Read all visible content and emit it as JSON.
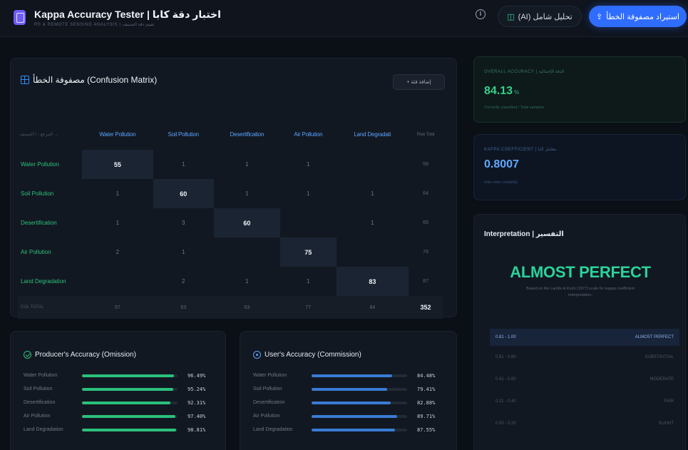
{
  "header": {
    "title": "Kappa Accuracy Tester | اختبار دقة كابا",
    "subtitle": "RS & REMOTE SENSING ANALYSIS | تقييم دقة التصنيف",
    "ai_button": "(AI) تحليل شامل",
    "import_button": "استيراد مصفوفة الخطأ"
  },
  "matrix": {
    "title": "مصفوفة الخطأ (Confusion Matrix)",
    "add_button": "+ إضافة فئة",
    "corner": "المرجع ↓ / المصنف →",
    "columns": [
      "Water Pollution",
      "Soil Pollution",
      "Desertification",
      "Air Pollution",
      "Land Degradati"
    ],
    "total_header": "Row Total",
    "rows": [
      {
        "name": "Water Pollution",
        "values": [
          "55",
          "1",
          "1",
          "1",
          ""
        ],
        "total": "58"
      },
      {
        "name": "Soil Pollution",
        "values": [
          "1",
          "60",
          "1",
          "1",
          "1"
        ],
        "total": "64"
      },
      {
        "name": "Desertification",
        "values": [
          "1",
          "3",
          "60",
          "",
          "1"
        ],
        "total": "65"
      },
      {
        "name": "Air Pollution",
        "values": [
          "2",
          "1",
          "",
          "75",
          ""
        ],
        "total": "78"
      },
      {
        "name": "Land Degradation",
        "values": [
          "",
          "2",
          "1",
          "1",
          "83"
        ],
        "total": "87"
      }
    ],
    "totals_label": "COL TOTAL",
    "col_totals": [
      "57",
      "63",
      "63",
      "77",
      "84"
    ],
    "grand_total": "352"
  },
  "producers": {
    "title": "Producer's Accuracy (Omission)",
    "color": "#2cc07c",
    "items": [
      {
        "name": "Water Pollution",
        "pct": "96.49%",
        "value": 0.9649
      },
      {
        "name": "Soil Pollution",
        "pct": "95.24%",
        "value": 0.9524
      },
      {
        "name": "Desertification",
        "pct": "92.31%",
        "value": 0.9231
      },
      {
        "name": "Air Pollution",
        "pct": "97.40%",
        "value": 0.974
      },
      {
        "name": "Land Degradation",
        "pct": "98.81%",
        "value": 0.9881
      }
    ]
  },
  "users": {
    "title": "User's Accuracy (Commission)",
    "color": "#3a7bd5",
    "items": [
      {
        "name": "Water Pollution",
        "pct": "84.48%",
        "value": 0.8448
      },
      {
        "name": "Soil Pollution",
        "pct": "79.41%",
        "value": 0.7941
      },
      {
        "name": "Desertification",
        "pct": "82.88%",
        "value": 0.8288
      },
      {
        "name": "Air Pollution",
        "pct": "89.71%",
        "value": 0.8971
      },
      {
        "name": "Land Degradation",
        "pct": "87.55%",
        "value": 0.8755
      }
    ]
  },
  "overall": {
    "label": "OVERALL ACCURACY | الدقة الإجمالية",
    "value": "84.13",
    "unit": "%",
    "note": "Correctly classified / Total samples"
  },
  "kappa": {
    "label": "KAPPA COEFFICIENT | معامل كابا",
    "value": "0.8007",
    "note": "Inter-rater reliability"
  },
  "interpretation": {
    "title": "Interpretation | التفسير",
    "level": "ALMOST PERFECT",
    "description": "Based on the Landis & Koch (1977) scale for kappa coefficient interpretation.",
    "scale": [
      {
        "range": "0.81 - 1.00",
        "label": "ALMOST PERFECT"
      },
      {
        "range": "0.61 - 0.80",
        "label": "SUBSTANTIAL"
      },
      {
        "range": "0.41 - 0.60",
        "label": "MODERATE"
      },
      {
        "range": "0.21 - 0.40",
        "label": "FAIR"
      },
      {
        "range": "0.00 - 0.20",
        "label": "SLIGHT"
      }
    ]
  }
}
